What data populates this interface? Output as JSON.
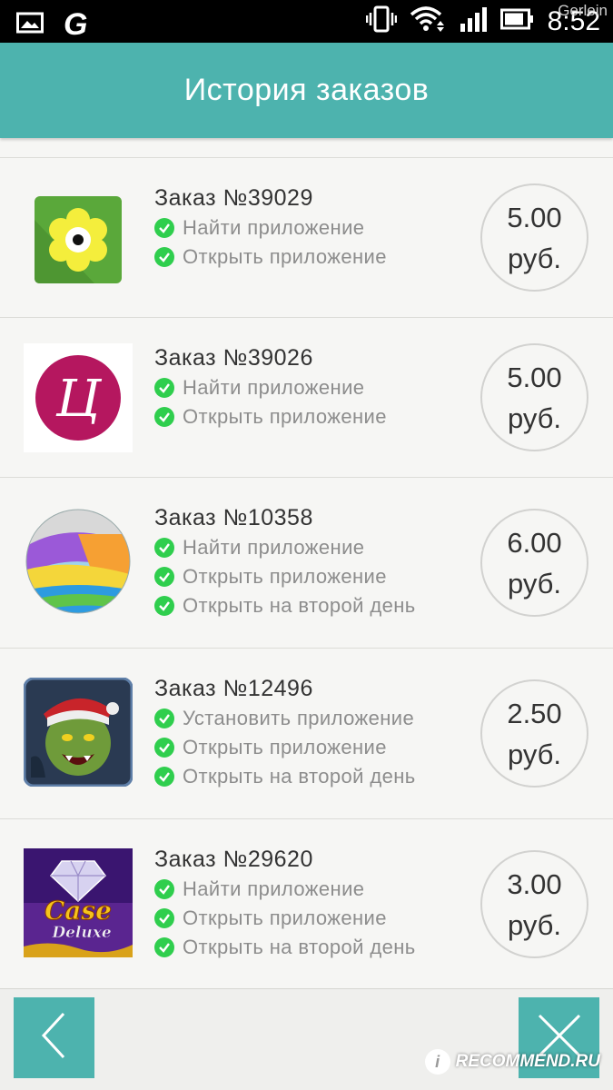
{
  "statusbar": {
    "time": "8:52",
    "watermark": "Gerlein",
    "icons": [
      "image-icon",
      "g-app-icon",
      "vibrate-icon",
      "wifi-icon",
      "signal-icon",
      "battery-icon"
    ]
  },
  "header": {
    "title": "История заказов"
  },
  "orders": [
    {
      "title": "Заказ №39029",
      "icon": "flower-app-icon",
      "tasks": [
        "Найти приложение",
        "Открыть приложение"
      ],
      "price_amount": "5.00",
      "price_currency": "руб."
    },
    {
      "title": "Заказ №39026",
      "icon": "letter-u-app-icon",
      "icon_letter": "Ц",
      "tasks": [
        "Найти приложение",
        "Открыть приложение"
      ],
      "price_amount": "5.00",
      "price_currency": "руб."
    },
    {
      "title": "Заказ №10358",
      "icon": "colorful-sphere-app-icon",
      "tasks": [
        "Найти приложение",
        "Открыть приложение",
        "Открыть на второй день"
      ],
      "price_amount": "6.00",
      "price_currency": "руб."
    },
    {
      "title": "Заказ №12496",
      "icon": "orc-game-app-icon",
      "tasks": [
        "Установить приложение",
        "Открыть приложение",
        "Открыть на второй день"
      ],
      "price_amount": "2.50",
      "price_currency": "руб."
    },
    {
      "title": "Заказ №29620",
      "icon": "case-deluxe-app-icon",
      "icon_text_1": "Case",
      "icon_text_2": "Deluxe",
      "tasks": [
        "Найти приложение",
        "Открыть приложение",
        "Открыть на второй день"
      ],
      "price_amount": "3.00",
      "price_currency": "руб."
    }
  ],
  "bottom": {
    "back_icon": "chevron-left-icon",
    "close_icon": "close-icon",
    "watermark": "RECOMMEND.RU"
  },
  "colors": {
    "accent": "#4db3ae",
    "check": "#2fce4d",
    "background": "#f6f6f4"
  }
}
